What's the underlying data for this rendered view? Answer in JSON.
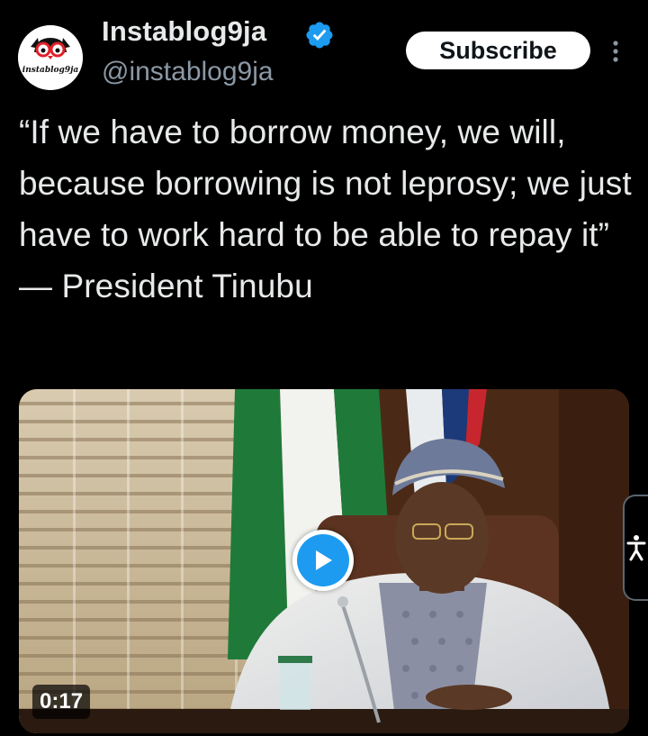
{
  "author": {
    "display_name": "Instablog9ja",
    "handle": "@instablog9ja",
    "verified": true,
    "avatar_logo_text": "instablog9ja"
  },
  "actions": {
    "subscribe_label": "Subscribe",
    "more_icon": "more-vertical-icon"
  },
  "tweet": {
    "text": "“If we have to borrow money, we will, because borrowing is not leprosy; we just have to work hard to be able to repay it” — President Tinubu"
  },
  "media": {
    "type": "video",
    "duration": "0:17",
    "play_icon": "play-icon"
  },
  "overlay": {
    "accessibility_icon": "accessibility-icon"
  },
  "colors": {
    "background": "#000000",
    "text_primary": "#e7e9ea",
    "text_secondary": "#8b98a5",
    "verified_blue": "#1d9bf0",
    "button_bg": "#ffffff"
  }
}
